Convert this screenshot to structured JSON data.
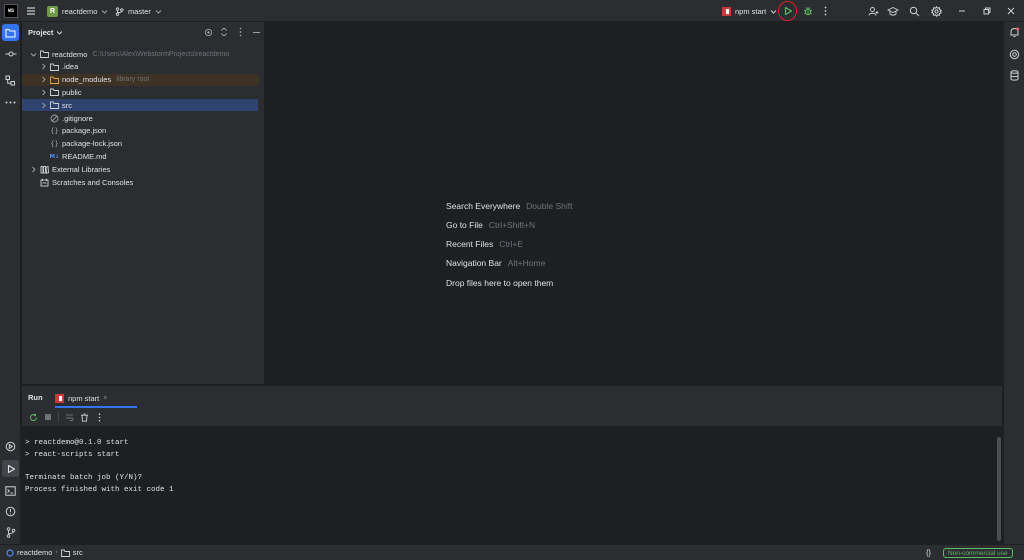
{
  "titlebar": {
    "app_logo": "WS",
    "menu_icon": "hamburger-icon",
    "project_badge": "R",
    "project_name": "reactdemo",
    "branch_name": "master",
    "run_config": "npm start",
    "icons": [
      "run-icon",
      "debug-icon",
      "more-icon",
      "add-user-icon",
      "learn-icon",
      "search-icon",
      "settings-icon",
      "minimize-icon",
      "restore-icon",
      "close-icon"
    ]
  },
  "left_strip": {
    "top": [
      "project-folder-icon",
      "commit-icon",
      "structure-icon",
      "more-tools-icon"
    ],
    "bottom": [
      "services-icon",
      "run-icon",
      "terminal-icon",
      "problems-icon",
      "git-icon"
    ]
  },
  "right_strip": [
    "notifications-icon",
    "ai-assistant-icon",
    "database-icon"
  ],
  "project_panel": {
    "title": "Project",
    "tools": [
      "locate-icon",
      "expand-collapse-icon",
      "options-icon",
      "hide-icon"
    ],
    "tree": [
      {
        "label": "reactdemo",
        "hint": "C:\\Users\\Alex\\WebstormProjects\\reactdemo",
        "icon": "folder",
        "chevron": "down",
        "level": 0,
        "state": ""
      },
      {
        "label": ".idea",
        "hint": "",
        "icon": "folder",
        "chevron": "right",
        "level": 1,
        "state": ""
      },
      {
        "label": "node_modules",
        "hint": "library root",
        "icon": "folder-orange",
        "chevron": "right",
        "level": 1,
        "state": "excluded"
      },
      {
        "label": "public",
        "hint": "",
        "icon": "folder",
        "chevron": "right",
        "level": 1,
        "state": ""
      },
      {
        "label": "src",
        "hint": "",
        "icon": "folder",
        "chevron": "right",
        "level": 1,
        "state": "selected"
      },
      {
        "label": ".gitignore",
        "hint": "",
        "icon": "ignore",
        "chevron": "",
        "level": 1,
        "state": ""
      },
      {
        "label": "package.json",
        "hint": "",
        "icon": "json",
        "chevron": "",
        "level": 1,
        "state": ""
      },
      {
        "label": "package-lock.json",
        "hint": "",
        "icon": "json",
        "chevron": "",
        "level": 1,
        "state": ""
      },
      {
        "label": "README.md",
        "hint": "",
        "icon": "markdown",
        "chevron": "",
        "level": 1,
        "state": ""
      },
      {
        "label": "External Libraries",
        "hint": "",
        "icon": "library",
        "chevron": "right",
        "level": 0,
        "state": ""
      },
      {
        "label": "Scratches and Consoles",
        "hint": "",
        "icon": "scratches",
        "chevron": "",
        "level": 0,
        "state": ""
      }
    ]
  },
  "editor": {
    "hints": [
      {
        "label": "Search Everywhere",
        "shortcut": "Double Shift"
      },
      {
        "label": "Go to File",
        "shortcut": "Ctrl+Shift+N"
      },
      {
        "label": "Recent Files",
        "shortcut": "Ctrl+E"
      },
      {
        "label": "Navigation Bar",
        "shortcut": "Alt+Home"
      },
      {
        "label": "Drop files here to open them",
        "shortcut": ""
      }
    ]
  },
  "run_window": {
    "title": "Run",
    "tab_label": "npm start",
    "tab_close": "×",
    "toolbar": [
      "rerun-icon",
      "stop-icon",
      "soft-wrap-icon",
      "clear-icon",
      "more-icon"
    ],
    "console_lines": [
      "> reactdemo@0.1.0 start",
      "> react-scripts start",
      "",
      "Terminate batch job (Y/N)?",
      "Process finished with exit code 1"
    ]
  },
  "status_bar": {
    "breadcrumbs": [
      "reactdemo",
      "src"
    ],
    "separator": "›",
    "json_indicator": "{}",
    "license": "Non-commercial use"
  },
  "colors": {
    "accent": "#3574f0",
    "run_green": "#5fb865",
    "highlight_circle": "#e0202a",
    "npm_red": "#cb3837"
  }
}
